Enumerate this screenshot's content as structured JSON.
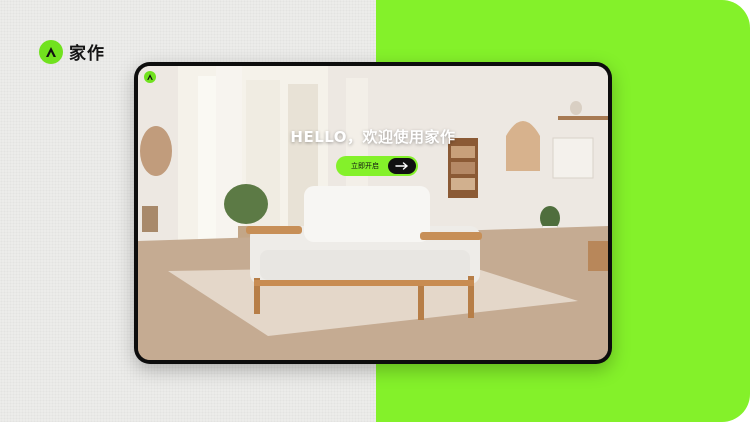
{
  "brand": {
    "name": "家作",
    "logo_icon": "brand-logo-icon",
    "accent": "#84f12a"
  },
  "hero": {
    "greeting": "HELLO，欢迎使用家作",
    "greeting_icon": "wave-hand-icon",
    "cta_label": "立即开启",
    "cta_icon": "arrow-right-icon"
  },
  "colors": {
    "left_panel": "#ececea",
    "right_panel": "#84f12a",
    "device_frame": "#0d0d0d"
  }
}
